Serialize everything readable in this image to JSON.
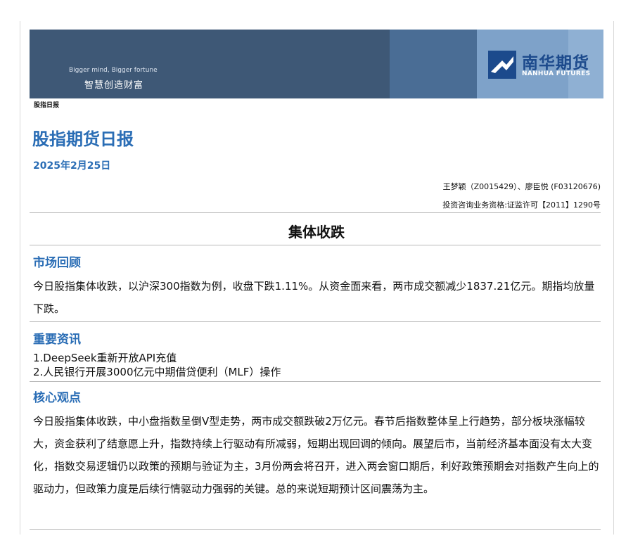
{
  "banner": {
    "slogan_en": "Bigger mind, Bigger fortune",
    "slogan_cn": "智慧创造财富",
    "logo_cn": "南华期货",
    "logo_en": "NANHUA FUTURES",
    "colors": {
      "dark": "#3e5876",
      "mid": "#4a6d95",
      "light": "#8fb0d3",
      "accent": "#2a6db5"
    }
  },
  "header": {
    "doc_label": "股指日报",
    "title": "股指期货日报",
    "date": "2025年2月25日",
    "authors": "王梦颖（Z0015429）、廖臣悦 (F03120676)",
    "license": "投资咨询业务资格:证监许可【2011】1290号"
  },
  "headline": "集体收跌",
  "sections": {
    "market_review": {
      "title": "市场回顾",
      "body": "今日股指集体收跌，以沪深300指数为例，收盘下跌1.11%。从资金面来看，两市成交额减少1837.21亿元。期指均放量下跌。"
    },
    "news": {
      "title": "重要资讯",
      "items": [
        "1.DeepSeek重新开放API充值",
        "2.人民银行开展3000亿元中期借贷便利（MLF）操作"
      ]
    },
    "core_view": {
      "title": "核心观点",
      "body": "今日股指集体收跌，中小盘指数呈倒V型走势，两市成交额跌破2万亿元。春节后指数整体呈上行趋势，部分板块涨幅较大，资金获利了结意愿上升，指数持续上行驱动有所减弱，短期出现回调的倾向。展望后市，当前经济基本面没有太大变化，指数交易逻辑仍以政策的预期与验证为主，3月份两会将召开，进入两会窗口期后，利好政策预期会对指数产生向上的驱动力，但政策力度是后续行情驱动力强弱的关键。总的来说短期预计区间震荡为主。"
    }
  }
}
